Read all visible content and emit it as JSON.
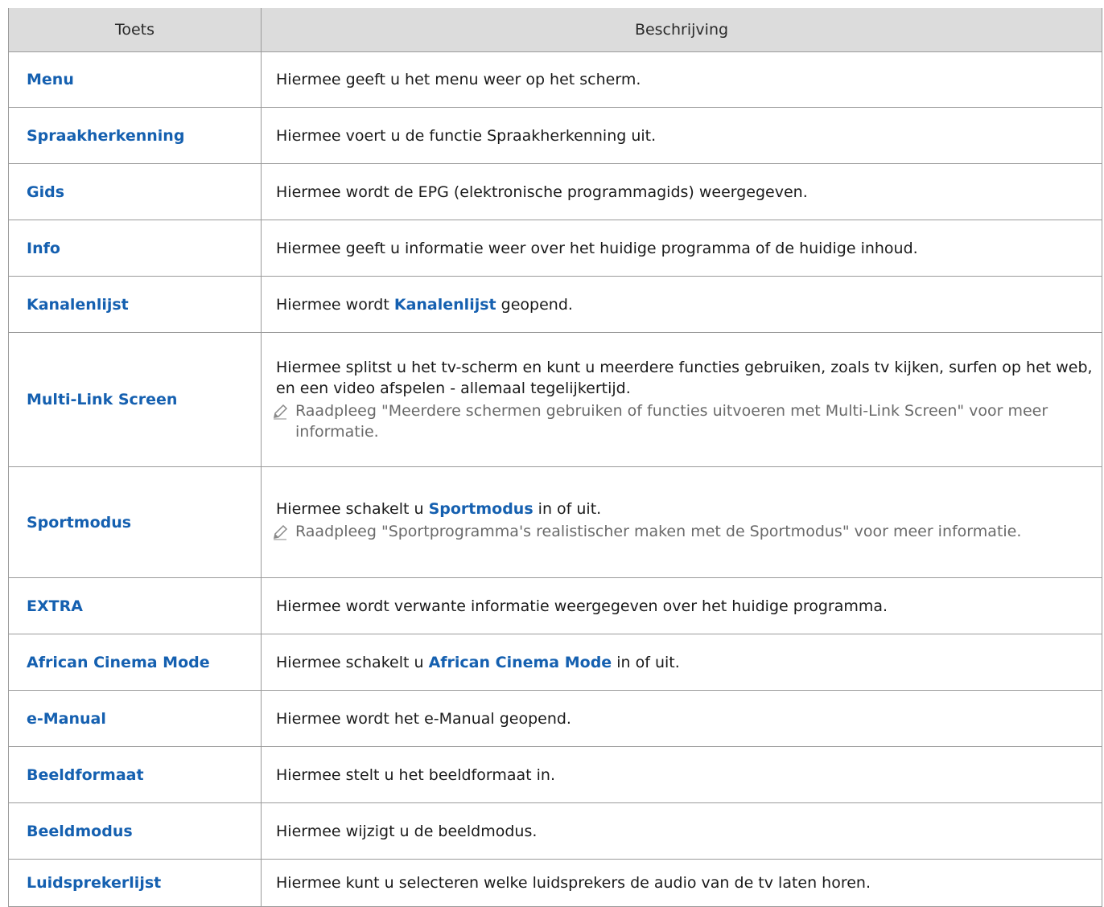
{
  "header": {
    "col_key": "Toets",
    "col_desc": "Beschrijving"
  },
  "rows": [
    {
      "key": "Menu",
      "desc": "Hiermee geeft u het menu weer op het scherm."
    },
    {
      "key": "Spraakherkenning",
      "desc": "Hiermee voert u de functie Spraakherkenning uit."
    },
    {
      "key": "Gids",
      "desc": "Hiermee wordt de EPG (elektronische programmagids) weergegeven."
    },
    {
      "key": "Info",
      "desc": "Hiermee geeft u informatie weer over het huidige programma of de huidige inhoud."
    },
    {
      "key": "Kanalenlijst",
      "desc_pre": "Hiermee wordt ",
      "desc_hl": "Kanalenlijst",
      "desc_post": " geopend."
    },
    {
      "key": "Multi-Link Screen",
      "desc": "Hiermee splitst u het tv-scherm en kunt u meerdere functies gebruiken, zoals tv kijken, surfen op het web, en een video afspelen - allemaal tegelijkertijd.",
      "note": "Raadpleeg \"Meerdere schermen gebruiken of functies uitvoeren met Multi-Link Screen\" voor meer informatie."
    },
    {
      "key": "Sportmodus",
      "desc_pre": "Hiermee schakelt u ",
      "desc_hl": "Sportmodus",
      "desc_post": " in of uit.",
      "note": "Raadpleeg \"Sportprogramma's realistischer maken met de Sportmodus\" voor meer informatie."
    },
    {
      "key": "EXTRA",
      "desc": "Hiermee wordt verwante informatie weergegeven over het huidige programma."
    },
    {
      "key": "African Cinema Mode",
      "desc_pre": "Hiermee schakelt u ",
      "desc_hl": "African Cinema Mode",
      "desc_post": " in of uit."
    },
    {
      "key": "e-Manual",
      "desc": "Hiermee wordt het e-Manual geopend."
    },
    {
      "key": "Beeldformaat",
      "desc": "Hiermee stelt u het beeldformaat in."
    },
    {
      "key": "Beeldmodus",
      "desc": "Hiermee wijzigt u de beeldmodus."
    },
    {
      "key": "Luidsprekerlijst",
      "desc": "Hiermee kunt u selecteren welke luidsprekers de audio van de tv laten horen."
    }
  ],
  "icons": {
    "note": "pencil-icon"
  },
  "colors": {
    "key_blue": "#1560b0",
    "header_bg": "#dcdcdc",
    "note_gray": "#6a6a6a"
  }
}
